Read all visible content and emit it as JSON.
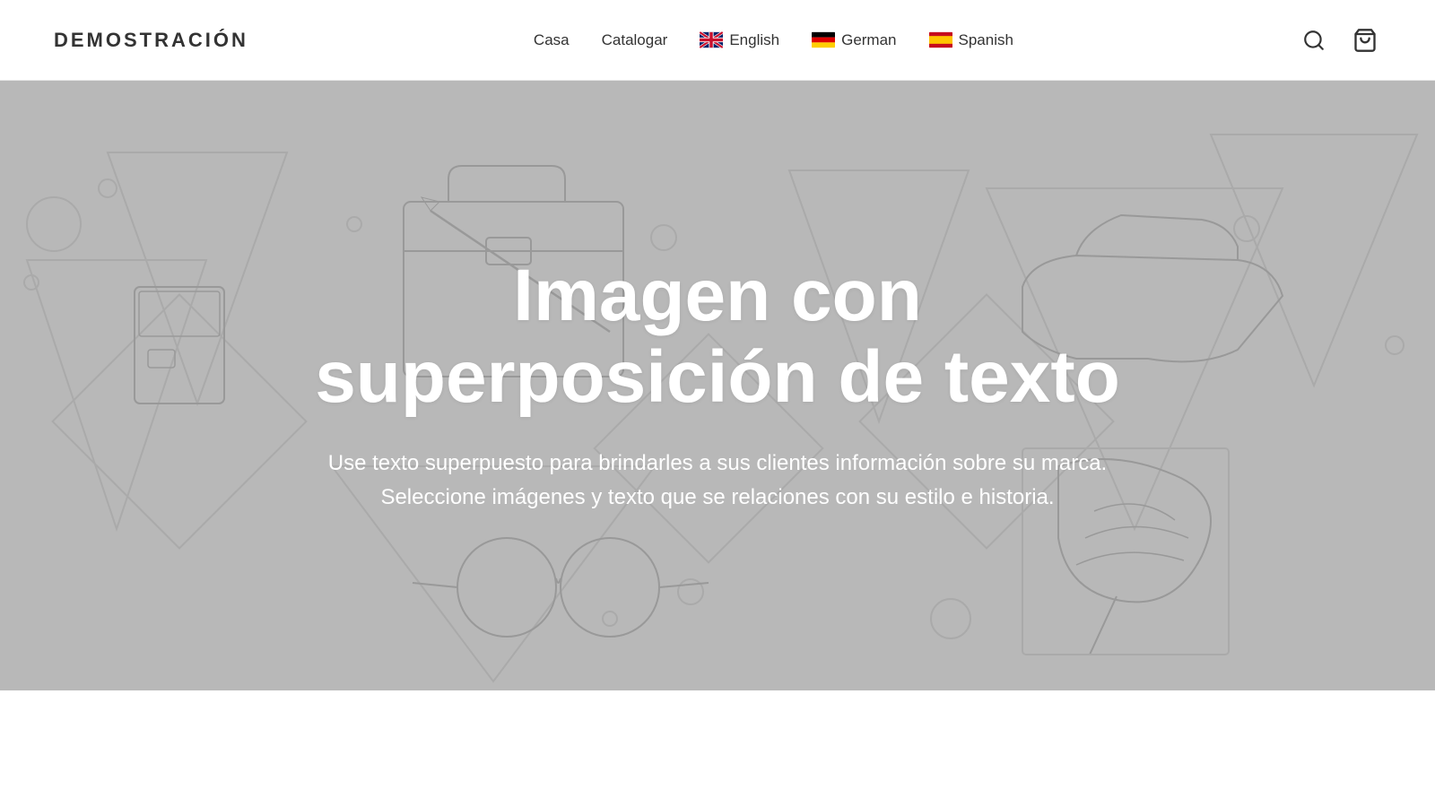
{
  "header": {
    "brand": "DEMOSTRACIÓN",
    "nav": {
      "casa_label": "Casa",
      "catalogar_label": "Catalogar"
    },
    "languages": [
      {
        "id": "english",
        "flag_type": "uk",
        "label": "English"
      },
      {
        "id": "german",
        "flag_type": "de",
        "label": "German"
      },
      {
        "id": "spanish",
        "flag_type": "es",
        "label": "Spanish"
      }
    ]
  },
  "hero": {
    "title": "Imagen con superposición de texto",
    "subtitle": "Use texto superpuesto para brindarles a sus clientes información sobre su marca. Seleccione imágenes y texto que se relaciones con su estilo e historia."
  },
  "icons": {
    "search": "🔍",
    "cart": "🛒"
  }
}
